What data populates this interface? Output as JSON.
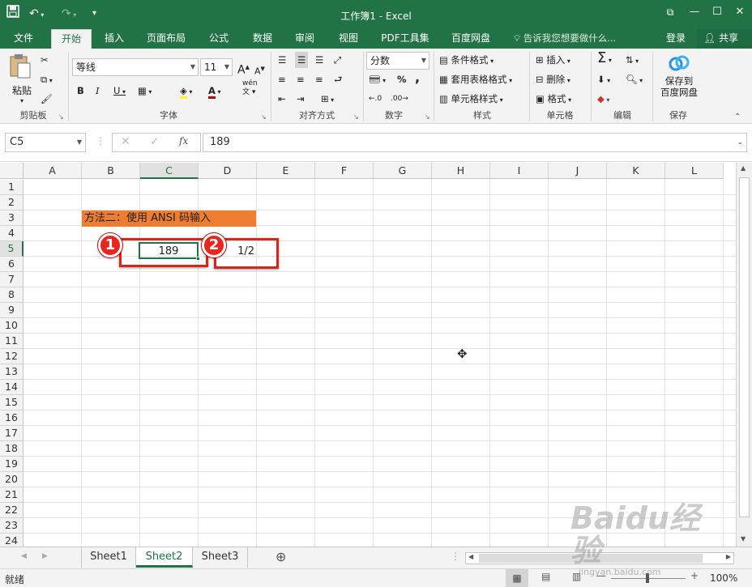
{
  "title": "工作簿1 - Excel",
  "tabs": [
    "文件",
    "开始",
    "插入",
    "页面布局",
    "公式",
    "数据",
    "审阅",
    "视图",
    "PDF工具集",
    "百度网盘"
  ],
  "tell_me": "告诉我您想要做什么...",
  "login": "登录",
  "share": "共享",
  "ribbon": {
    "clipboard": {
      "paste": "粘贴",
      "label": "剪贴板"
    },
    "font": {
      "name": "等线",
      "size": "11",
      "label": "字体",
      "grow": "A",
      "shrink": "A",
      "bold": "B",
      "italic": "I",
      "underline": "U",
      "wen": "wén",
      "fontcolor": "A"
    },
    "align": {
      "label": "对齐方式"
    },
    "number": {
      "format": "分数",
      "label": "数字",
      "percent": "%",
      "comma": ","
    },
    "styles": {
      "cond": "条件格式",
      "table": "套用表格格式",
      "cell": "单元格样式",
      "label": "样式"
    },
    "cells": {
      "insert": "插入",
      "delete": "删除",
      "format": "格式",
      "label": "单元格"
    },
    "edit": {
      "label": "编辑"
    },
    "save": {
      "line1": "保存到",
      "line2": "百度网盘",
      "label": "保存"
    }
  },
  "formula_bar": {
    "name_box": "C5",
    "value": "189",
    "fx": "fx"
  },
  "columns": [
    "A",
    "B",
    "C",
    "D",
    "E",
    "F",
    "G",
    "H",
    "I",
    "J",
    "K",
    "L"
  ],
  "rows": [
    "1",
    "2",
    "3",
    "4",
    "5",
    "6",
    "7",
    "8",
    "9",
    "10",
    "11",
    "12",
    "13",
    "14",
    "15",
    "16",
    "17",
    "18",
    "19",
    "20",
    "21",
    "22",
    "23",
    "24"
  ],
  "cells": {
    "B3": "方法二：使用 ANSI 码输入",
    "C5": "189",
    "D5": "1/2"
  },
  "annotations": [
    "1",
    "2"
  ],
  "sheets": [
    "Sheet1",
    "Sheet2",
    "Sheet3"
  ],
  "status": {
    "ready": "就绪",
    "zoom": "100%"
  },
  "colors": {
    "excel_green": "#217346",
    "highlight": "#ed7d31",
    "annotation_red": "#e8251e"
  },
  "watermark": {
    "brand": "Baidu经验",
    "url": "jingyan.baidu.com"
  }
}
